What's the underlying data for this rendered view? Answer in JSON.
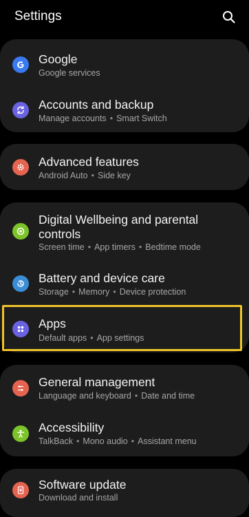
{
  "header": {
    "title": "Settings",
    "search_icon": "search-icon"
  },
  "colors": {
    "highlight": "#f0c428",
    "google": "#3a7af0",
    "accounts": "#6a63e0",
    "advanced": "#e46450",
    "wellbeing": "#7cc42a",
    "battery": "#3a8ed6",
    "apps": "#6a63e0",
    "general": "#e46450",
    "accessibility": "#7cc42a",
    "software": "#e46450"
  },
  "items": [
    {
      "label": "Google",
      "subs": [
        "Google services"
      ],
      "icon": "google-g-icon"
    },
    {
      "label": "Accounts and backup",
      "subs": [
        "Manage accounts",
        "Smart Switch"
      ],
      "icon": "sync-icon"
    },
    {
      "label": "Advanced features",
      "subs": [
        "Android Auto",
        "Side key"
      ],
      "icon": "gear-plus-icon"
    },
    {
      "label_line1": "Digital Wellbeing and parental",
      "label_line2": "controls",
      "subs": [
        "Screen time",
        "App timers",
        "Bedtime mode"
      ],
      "icon": "wellbeing-icon"
    },
    {
      "label": "Battery and device care",
      "subs": [
        "Storage",
        "Memory",
        "Device protection"
      ],
      "icon": "device-care-icon"
    },
    {
      "label": "Apps",
      "subs": [
        "Default apps",
        "App settings"
      ],
      "icon": "apps-grid-icon"
    },
    {
      "label": "General management",
      "subs": [
        "Language and keyboard",
        "Date and time"
      ],
      "icon": "sliders-icon"
    },
    {
      "label": "Accessibility",
      "subs": [
        "TalkBack",
        "Mono audio",
        "Assistant menu"
      ],
      "icon": "accessibility-icon"
    },
    {
      "label": "Software update",
      "subs": [
        "Download and install"
      ],
      "icon": "software-update-icon"
    }
  ]
}
